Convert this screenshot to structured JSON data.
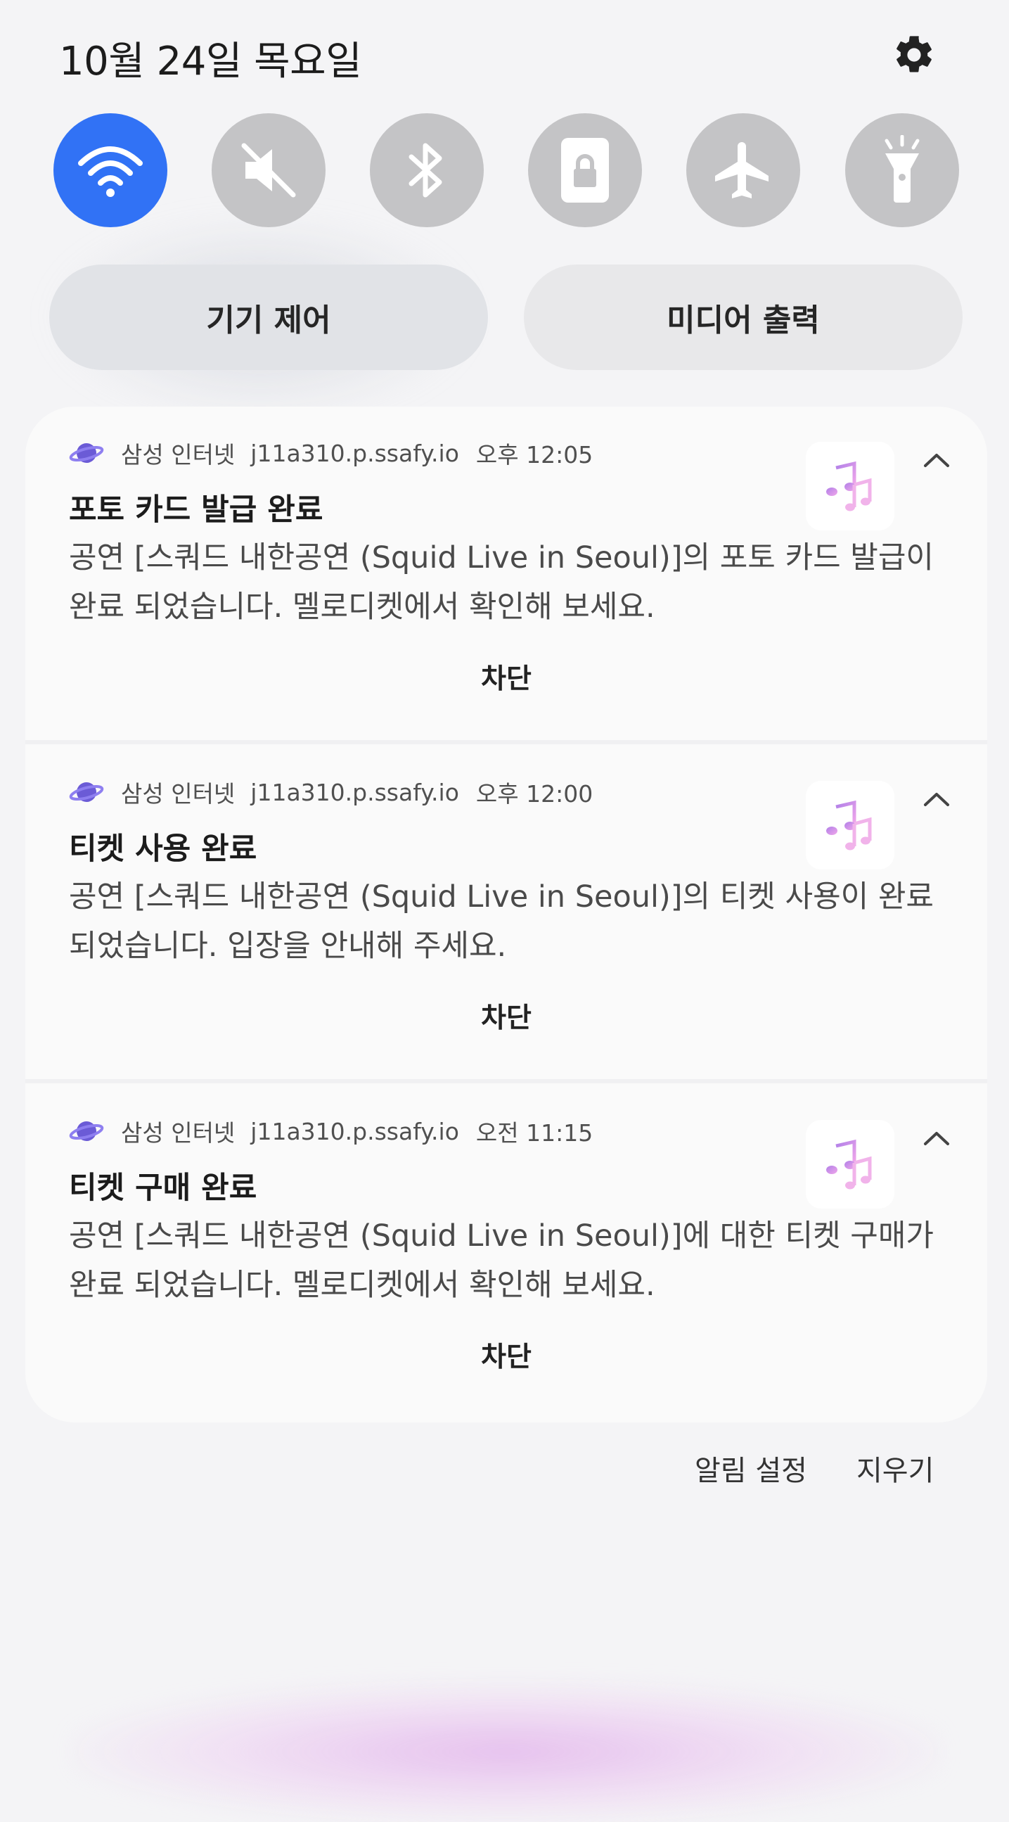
{
  "header": {
    "date": "10월 24일 목요일"
  },
  "quick_toggles": [
    {
      "name": "wifi",
      "icon": "wifi-icon",
      "active": true
    },
    {
      "name": "sound",
      "icon": "mute-icon",
      "active": false
    },
    {
      "name": "bluetooth",
      "icon": "bluetooth-icon",
      "active": false
    },
    {
      "name": "rotation-lock",
      "icon": "portrait-lock-icon",
      "active": false
    },
    {
      "name": "airplane-mode",
      "icon": "airplane-icon",
      "active": false
    },
    {
      "name": "flashlight",
      "icon": "flashlight-icon",
      "active": false
    }
  ],
  "pills": {
    "device_control": "기기 제어",
    "media_output": "미디어 출력"
  },
  "notifications": [
    {
      "app": "삼성 인터넷",
      "site": "j11a310.p.ssafy.io",
      "time": "오후 12:05",
      "title": "포토 카드 발급 완료",
      "body": "공연 [스쿼드 내한공연 (Squid Live in Seoul)]의 포토 카드 발급이 완료 되었습니다. 멜로디켓에서 확인해 보세요.",
      "action": "차단"
    },
    {
      "app": "삼성 인터넷",
      "site": "j11a310.p.ssafy.io",
      "time": "오후 12:00",
      "title": "티켓 사용 완료",
      "body": "공연 [스쿼드 내한공연 (Squid Live in Seoul)]의 티켓 사용이 완료 되었습니다. 입장을 안내해 주세요.",
      "action": "차단"
    },
    {
      "app": "삼성 인터넷",
      "site": "j11a310.p.ssafy.io",
      "time": "오전 11:15",
      "title": "티켓 구매 완료",
      "body": "공연 [스쿼드 내한공연 (Squid Live in Seoul)]에 대한 티켓 구매가 완료 되었습니다. 멜로디켓에서 확인해 보세요.",
      "action": "차단"
    }
  ],
  "footer": {
    "notification_settings": "알림 설정",
    "clear": "지우기"
  },
  "colors": {
    "accent": "#3172f5",
    "toggle_off": "#c4c4c6",
    "background": "#f4f4f6",
    "card": "#fafafa"
  }
}
